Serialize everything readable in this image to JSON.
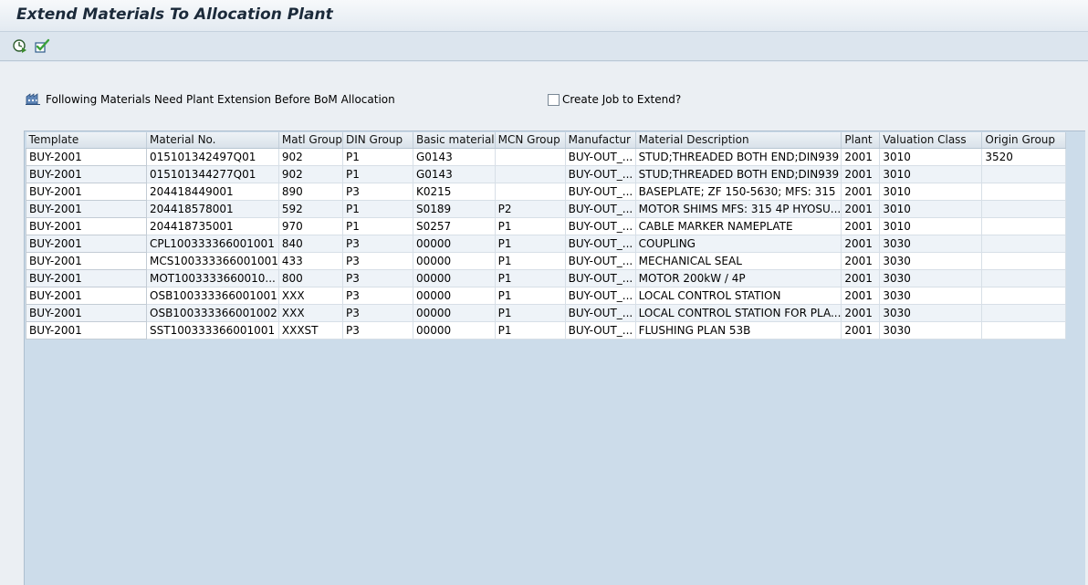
{
  "window": {
    "title": "Extend Materials To Allocation Plant"
  },
  "toolbar": {
    "buttons": [
      {
        "icon": "execute-clock-icon"
      },
      {
        "icon": "check-approve-icon"
      }
    ]
  },
  "info": {
    "icon": "factory-icon",
    "message": "Following Materials Need Plant Extension Before BoM Allocation"
  },
  "create_job": {
    "label": "Create Job to Extend?",
    "checked": false
  },
  "grid": {
    "columns": [
      "Template",
      "Material No.",
      "Matl Group",
      "DIN Group",
      "Basic material",
      "MCN Group",
      "Manufactur",
      "Material Description",
      "Plant",
      "Valuation Class",
      "Origin Group"
    ],
    "rows": [
      [
        "BUY-2001",
        "015101342497Q01",
        "902",
        "P1",
        "G0143",
        "",
        "BUY-OUT_...",
        "STUD;THREADED BOTH END;DIN939",
        "2001",
        "3010",
        "3520"
      ],
      [
        "BUY-2001",
        "015101344277Q01",
        "902",
        "P1",
        "G0143",
        "",
        "BUY-OUT_...",
        "STUD;THREADED BOTH END;DIN939",
        "2001",
        "3010",
        ""
      ],
      [
        "BUY-2001",
        "204418449001",
        "890",
        "P3",
        "K0215",
        "",
        "BUY-OUT_...",
        "BASEPLATE; ZF 150-5630; MFS: 315",
        "2001",
        "3010",
        ""
      ],
      [
        "BUY-2001",
        "204418578001",
        "592",
        "P1",
        "S0189",
        "P2",
        "BUY-OUT_...",
        "MOTOR SHIMS MFS: 315 4P HYOSU...",
        "2001",
        "3010",
        ""
      ],
      [
        "BUY-2001",
        "204418735001",
        "970",
        "P1",
        "S0257",
        "P1",
        "BUY-OUT_...",
        "CABLE MARKER NAMEPLATE",
        "2001",
        "3010",
        ""
      ],
      [
        "BUY-2001",
        "CPL100333366001001",
        "840",
        "P3",
        "00000",
        "P1",
        "BUY-OUT_...",
        "COUPLING",
        "2001",
        "3030",
        ""
      ],
      [
        "BUY-2001",
        "MCS100333366001001",
        "433",
        "P3",
        "00000",
        "P1",
        "BUY-OUT_...",
        "MECHANICAL SEAL",
        "2001",
        "3030",
        ""
      ],
      [
        "BUY-2001",
        "MOT1003333660010...",
        "800",
        "P3",
        "00000",
        "P1",
        "BUY-OUT_...",
        "MOTOR 200kW / 4P",
        "2001",
        "3030",
        ""
      ],
      [
        "BUY-2001",
        "OSB100333366001001",
        "XXX",
        "P3",
        "00000",
        "P1",
        "BUY-OUT_...",
        "LOCAL CONTROL STATION",
        "2001",
        "3030",
        ""
      ],
      [
        "BUY-2001",
        "OSB100333366001002",
        "XXX",
        "P3",
        "00000",
        "P1",
        "BUY-OUT_...",
        "LOCAL CONTROL STATION FOR PLA...",
        "2001",
        "3030",
        ""
      ],
      [
        "BUY-2001",
        "SST100333366001001",
        "XXXST",
        "P3",
        "00000",
        "P1",
        "BUY-OUT_...",
        "FLUSHING PLAN 53B",
        "2001",
        "3030",
        ""
      ]
    ]
  }
}
